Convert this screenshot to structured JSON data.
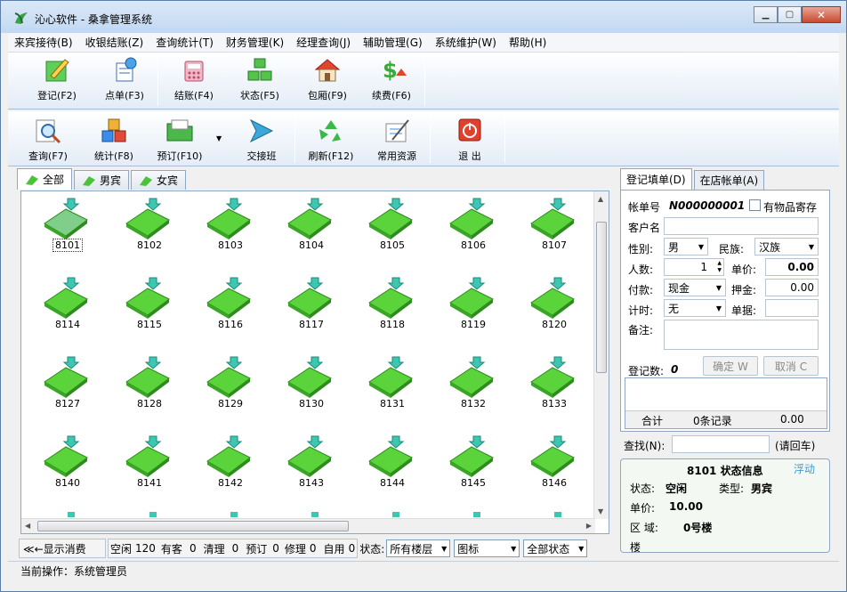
{
  "window": {
    "title": "沁心软件 - 桑拿管理系统"
  },
  "menu": [
    "来宾接待(B)",
    "收银结账(Z)",
    "查询统计(T)",
    "财务管理(K)",
    "经理查询(J)",
    "辅助管理(G)",
    "系统维护(W)",
    "帮助(H)"
  ],
  "toolbar1": [
    {
      "label": "登记(F2)",
      "icon": "register-icon"
    },
    {
      "label": "点单(F3)",
      "icon": "order-icon"
    },
    {
      "label": "结账(F4)",
      "icon": "checkout-icon"
    },
    {
      "label": "状态(F5)",
      "icon": "status-icon"
    },
    {
      "label": "包厢(F9)",
      "icon": "room-house-icon"
    },
    {
      "label": "续费(F6)",
      "icon": "renew-icon"
    }
  ],
  "toolbar2": [
    {
      "label": "查询(F7)",
      "icon": "query-icon"
    },
    {
      "label": "统计(F8)",
      "icon": "statistics-icon"
    },
    {
      "label": "预订(F10)",
      "icon": "booking-icon"
    },
    {
      "label": "交接班",
      "icon": "shift-handover-icon"
    },
    {
      "label": "刷新(F12)",
      "icon": "refresh-icon"
    },
    {
      "label": "常用资源",
      "icon": "resources-icon"
    },
    {
      "label": "退  出",
      "icon": "exit-icon"
    }
  ],
  "tabs": [
    "全部",
    "男宾",
    "女宾"
  ],
  "rooms": [
    "8101",
    "8102",
    "8103",
    "8104",
    "8105",
    "8106",
    "8107",
    "8114",
    "8115",
    "8116",
    "8117",
    "8118",
    "8119",
    "8120",
    "8127",
    "8128",
    "8129",
    "8130",
    "8131",
    "8132",
    "8133",
    "8140",
    "8141",
    "8142",
    "8143",
    "8144",
    "8145",
    "8146"
  ],
  "statusbar": {
    "toggle": "≪←显示消费",
    "counts": [
      {
        "label": "空闲",
        "value": "120"
      },
      {
        "label": "有客",
        "value": "0"
      },
      {
        "label": "清理",
        "value": "0"
      },
      {
        "label": "预订",
        "value": "0"
      },
      {
        "label": "修理",
        "value": "0"
      },
      {
        "label": "自用",
        "value": "0"
      }
    ],
    "state_label": "状态:",
    "floor": "所有楼层",
    "view": "图标",
    "filter": "全部状态"
  },
  "bottom_status": "当前操作：系统管理员",
  "right": {
    "tabs": [
      "登记填单(D)",
      "在店帐单(A)"
    ],
    "form": {
      "bill_label": "帐单号",
      "bill_no": "N000000001",
      "deposit_label": "有物品寄存",
      "customer_label": "客户名",
      "gender_label": "性别:",
      "gender": "男",
      "ethnic_label": "民族:",
      "ethnic": "汉族",
      "people_label": "人数:",
      "people": "1",
      "price_label": "单价:",
      "price": "0.00",
      "pay_label": "付款:",
      "pay": "现金",
      "deposit_money_label": "押金:",
      "deposit_money": "0.00",
      "timing_label": "计时:",
      "timing": "无",
      "receipt_label": "单据:",
      "note_label": "备注:",
      "count_label": "登记数:",
      "count": "0",
      "confirm": "确定 W",
      "cancel": "取消 C",
      "total_label": "合计",
      "total_records": "0条记录",
      "total_amount": "0.00"
    },
    "search": {
      "label": "查找(N):",
      "hint": "(请回车)"
    },
    "info": {
      "title": "8101 状态信息",
      "float": "浮动",
      "state_label": "状态:",
      "state": "空闲",
      "type_label": "类型:",
      "type": "男宾",
      "price_label": "单价:",
      "price": "10.00",
      "area_label": "区    域:",
      "area": "0号楼",
      "floor_label": "楼"
    }
  },
  "colors": {
    "accent": "#3c9bd6",
    "room_green": "#5bd43c",
    "titlebar": "#c2d8f1"
  }
}
